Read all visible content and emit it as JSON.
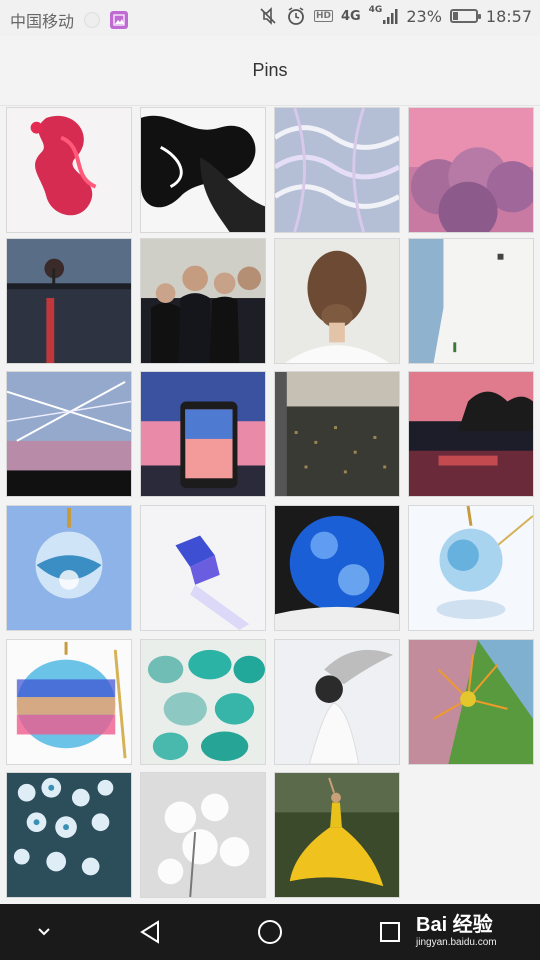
{
  "status_bar": {
    "carrier": "中国移动",
    "network": "4G",
    "network2": "4G",
    "hd_label": "HD",
    "battery_percent": "23%",
    "battery_level": 0.23,
    "time": "18:57",
    "icons": [
      "dot-icon",
      "photo-notification-icon",
      "mute-icon",
      "alarm-icon",
      "hd-icon",
      "network-4g-icon",
      "signal-icon",
      "battery-icon"
    ]
  },
  "header": {
    "title": "Pins"
  },
  "pins": [
    {
      "name": "pin-red-ink",
      "subject": "red ink in water"
    },
    {
      "name": "pin-black-ink",
      "subject": "black ink in water"
    },
    {
      "name": "pin-pool-water",
      "subject": "pool water caustics"
    },
    {
      "name": "pin-pink-clouds",
      "subject": "pink clouds"
    },
    {
      "name": "pin-lake-sunset",
      "subject": "lake at sunset with tree"
    },
    {
      "name": "pin-group-people",
      "subject": "group of people"
    },
    {
      "name": "pin-hair-bun",
      "subject": "hair bun"
    },
    {
      "name": "pin-white-wall",
      "subject": "white wall and sky"
    },
    {
      "name": "pin-contrails-sky",
      "subject": "contrails in sky"
    },
    {
      "name": "pin-phone-sunset",
      "subject": "phone photographing sunset"
    },
    {
      "name": "pin-city-view",
      "subject": "city view from height"
    },
    {
      "name": "pin-dusk-street",
      "subject": "dusk street reflection"
    },
    {
      "name": "pin-globe-pendant",
      "subject": "glass globe pendant"
    },
    {
      "name": "pin-crystal-cube",
      "subject": "blue crystal cube"
    },
    {
      "name": "pin-blue-orb",
      "subject": "blue resin orb"
    },
    {
      "name": "pin-resin-pendant",
      "subject": "resin sphere pendant"
    },
    {
      "name": "pin-apple-pendant",
      "subject": "rainbow apple pendant"
    },
    {
      "name": "pin-painted-stones",
      "subject": "painted teal stones"
    },
    {
      "name": "pin-winged-girl",
      "subject": "girl with wings"
    },
    {
      "name": "pin-macro-flower",
      "subject": "macro flower"
    },
    {
      "name": "pin-blue-blossoms",
      "subject": "blue white blossoms"
    },
    {
      "name": "pin-white-flowers",
      "subject": "white flowers"
    },
    {
      "name": "pin-yellow-dress",
      "subject": "woman in yellow dress"
    }
  ],
  "navbar": {
    "icons": [
      "chevron-down-icon",
      "back-icon",
      "home-icon",
      "recents-icon"
    ],
    "watermark_logo": "Bai  经验",
    "watermark_url": "jingyan.baidu.com"
  },
  "colors": {
    "background": "#f3f3f3",
    "navbar": "#1a1a1a",
    "photo_notification": "#c06bd4"
  }
}
